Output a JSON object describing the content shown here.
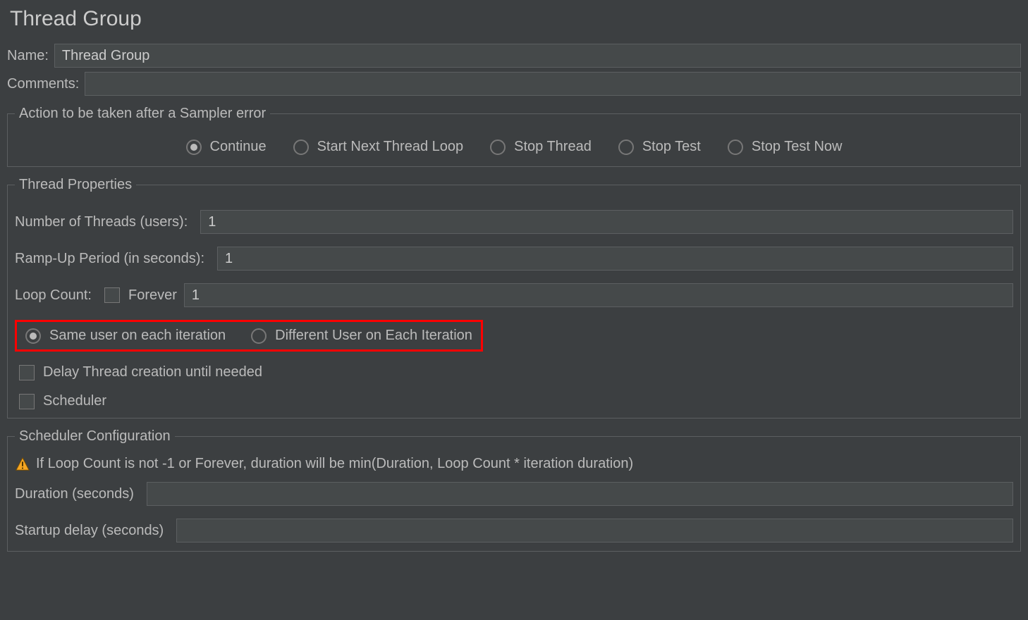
{
  "title": "Thread Group",
  "nameLabel": "Name:",
  "nameValue": "Thread Group",
  "commentsLabel": "Comments:",
  "commentsValue": "",
  "errorAction": {
    "legend": "Action to be taken after a Sampler error",
    "options": [
      {
        "label": "Continue",
        "checked": true
      },
      {
        "label": "Start Next Thread Loop",
        "checked": false
      },
      {
        "label": "Stop Thread",
        "checked": false
      },
      {
        "label": "Stop Test",
        "checked": false
      },
      {
        "label": "Stop Test Now",
        "checked": false
      }
    ]
  },
  "threadProps": {
    "legend": "Thread Properties",
    "numThreadsLabel": "Number of Threads (users):",
    "numThreadsValue": "1",
    "rampUpLabel": "Ramp-Up Period (in seconds):",
    "rampUpValue": "1",
    "loopCountLabel": "Loop Count:",
    "foreverLabel": "Forever",
    "loopCountValue": "1",
    "userIter": {
      "sameLabel": "Same user on each iteration",
      "sameChecked": true,
      "diffLabel": "Different User on Each Iteration",
      "diffChecked": false
    },
    "delayLabel": "Delay Thread creation until needed",
    "schedulerLabel": "Scheduler"
  },
  "schedConfig": {
    "legend": "Scheduler Configuration",
    "note": "If Loop Count is not -1 or Forever, duration will be min(Duration, Loop Count * iteration duration)",
    "durationLabel": "Duration (seconds)",
    "durationValue": "",
    "startupLabel": "Startup delay (seconds)",
    "startupValue": ""
  }
}
